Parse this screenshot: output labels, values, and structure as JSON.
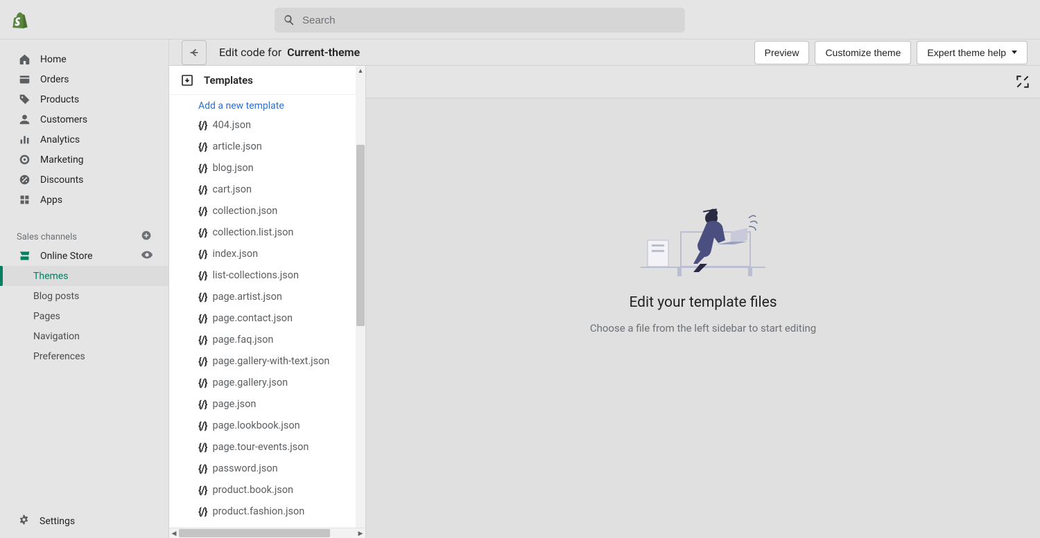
{
  "search": {
    "placeholder": "Search"
  },
  "nav": {
    "items": [
      {
        "label": "Home"
      },
      {
        "label": "Orders"
      },
      {
        "label": "Products"
      },
      {
        "label": "Customers"
      },
      {
        "label": "Analytics"
      },
      {
        "label": "Marketing"
      },
      {
        "label": "Discounts"
      },
      {
        "label": "Apps"
      }
    ],
    "section_label": "Sales channels",
    "online_store": "Online Store",
    "sub": [
      {
        "label": "Themes",
        "active": true
      },
      {
        "label": "Blog posts"
      },
      {
        "label": "Pages"
      },
      {
        "label": "Navigation"
      },
      {
        "label": "Preferences"
      }
    ],
    "settings": "Settings"
  },
  "toolbar": {
    "title_prefix": "Edit code for",
    "title_theme": "Current-theme",
    "preview": "Preview",
    "customize": "Customize theme",
    "help": "Expert theme help"
  },
  "filetree": {
    "folder": "Templates",
    "add_link": "Add a new template",
    "files": [
      "404.json",
      "article.json",
      "blog.json",
      "cart.json",
      "collection.json",
      "collection.list.json",
      "index.json",
      "list-collections.json",
      "page.artist.json",
      "page.contact.json",
      "page.faq.json",
      "page.gallery-with-text.json",
      "page.gallery.json",
      "page.json",
      "page.lookbook.json",
      "page.tour-events.json",
      "password.json",
      "product.book.json",
      "product.fashion.json"
    ]
  },
  "editor": {
    "empty_title": "Edit your template files",
    "empty_sub": "Choose a file from the left sidebar to start editing"
  }
}
